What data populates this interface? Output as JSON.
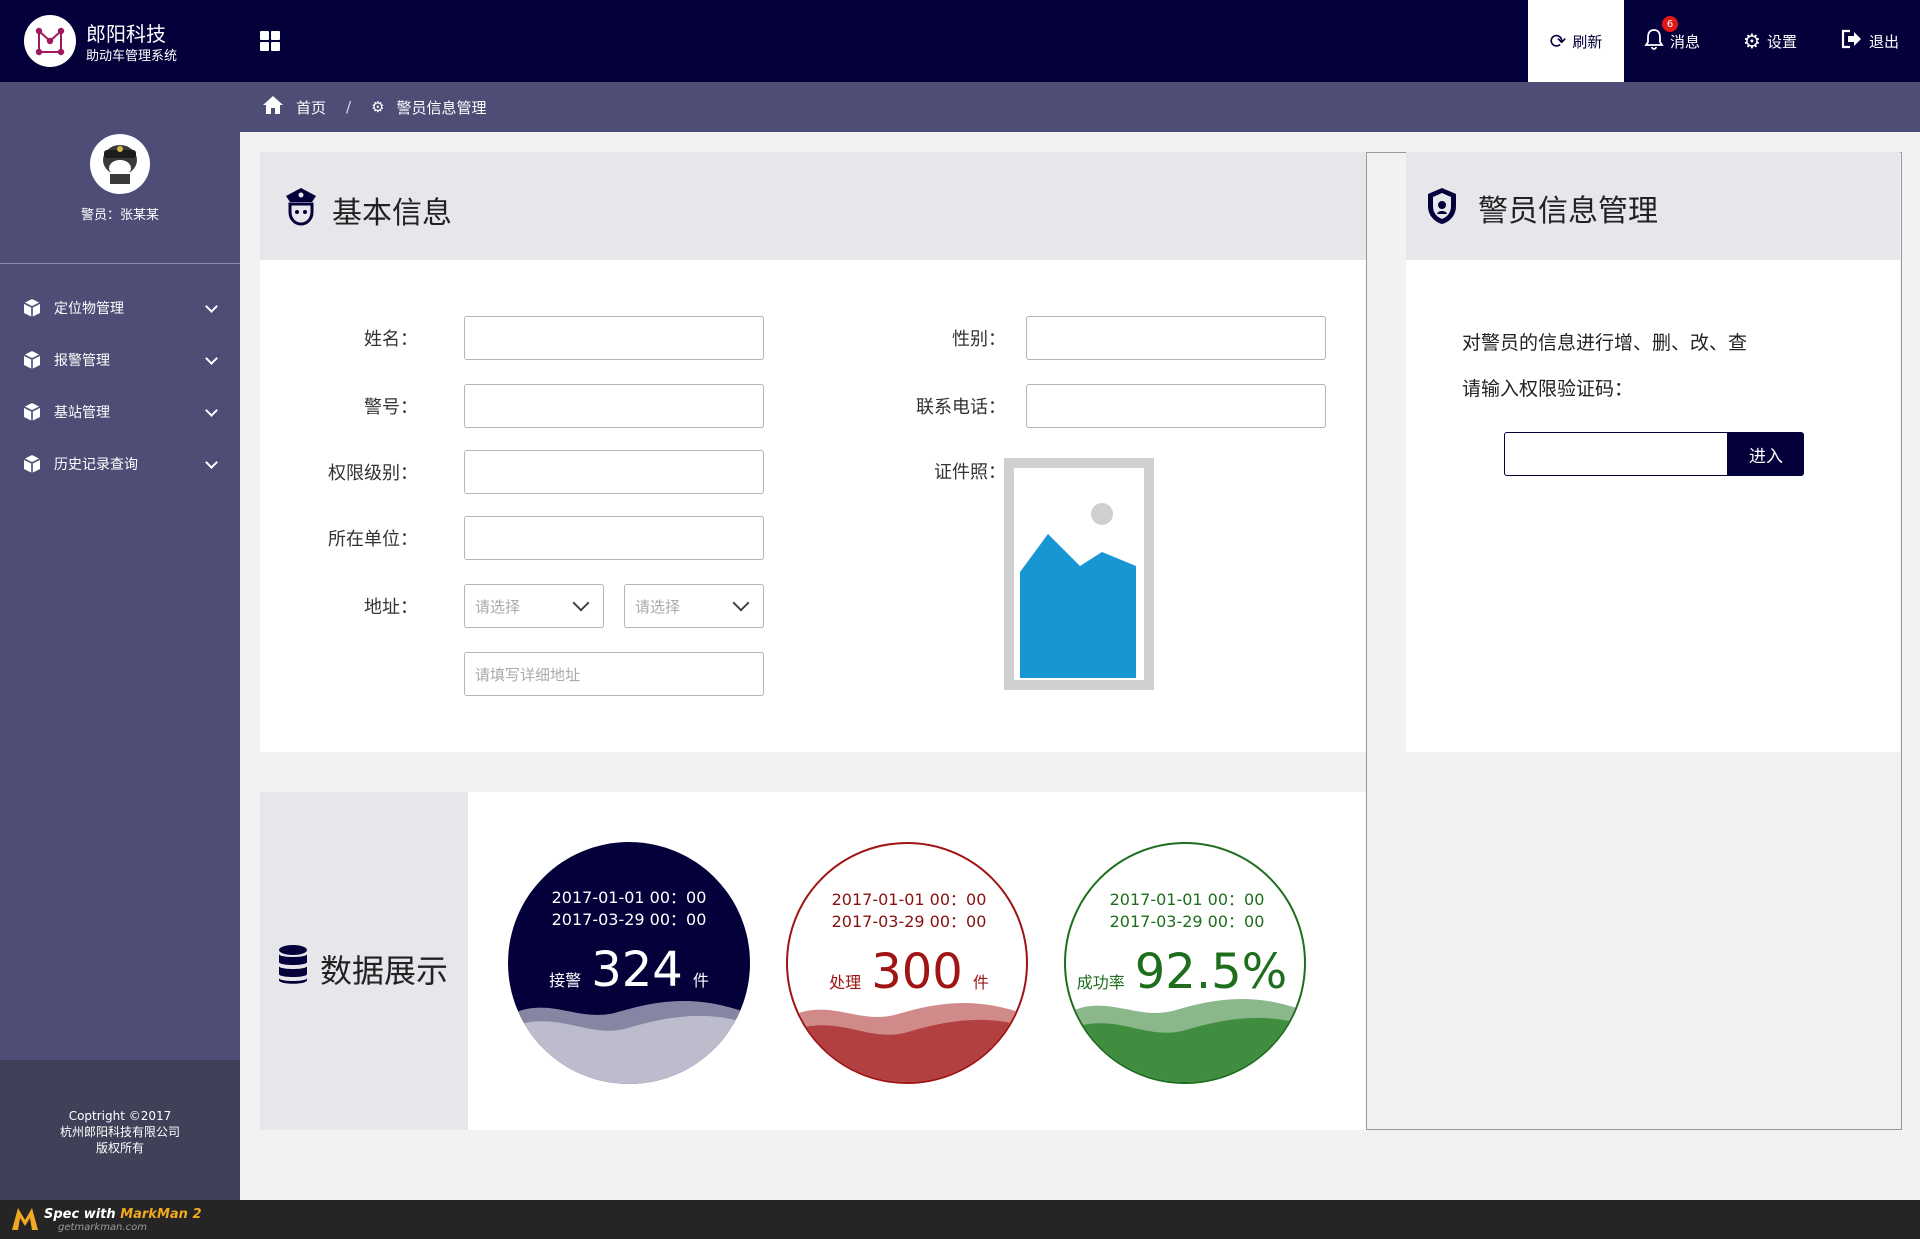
{
  "brand": {
    "name": "郎阳科技",
    "subtitle": "助动车管理系统"
  },
  "toolbar": {
    "refresh_label": "刷新",
    "messages_label": "消息",
    "messages_count": "6",
    "settings_label": "设置",
    "logout_label": "退出"
  },
  "user": {
    "display_name": "警员：张某某"
  },
  "sidebar": {
    "items": [
      {
        "label": "定位物管理"
      },
      {
        "label": "报警管理"
      },
      {
        "label": "基站管理"
      },
      {
        "label": "历史记录查询"
      }
    ],
    "footer_line1": "Coptright ©2017",
    "footer_line2": "杭州郎阳科技有限公司",
    "footer_line3": "版权所有"
  },
  "breadcrumb": {
    "home": "首页",
    "separator": "/",
    "current": "警员信息管理"
  },
  "basic_info": {
    "title": "基本信息",
    "name_label": "姓名：",
    "badge_label": "警号：",
    "permission_label": "权限级别：",
    "unit_label": "所在单位：",
    "address_label": "地址：",
    "province_placeholder": "请选择",
    "city_placeholder": "请选择",
    "address_detail_placeholder": "请填写详细地址",
    "gender_label": "性别：",
    "phone_label": "联系电话：",
    "id_photo_label": "证件照："
  },
  "manage": {
    "title": "警员信息管理",
    "description": "对警员的信息进行增、删、改、查",
    "prompt": "请输入权限验证码：",
    "enter_label": "进入"
  },
  "data_display": {
    "title": "数据展示",
    "cards": [
      {
        "date_from": "2017-01-01 00：00",
        "date_to": "2017-03-29 00：00",
        "label": "接警",
        "value": "324",
        "unit": "件",
        "color": "#03003a"
      },
      {
        "date_from": "2017-01-01 00：00",
        "date_to": "2017-03-29 00：00",
        "label": "处理",
        "value": "300",
        "unit": "件",
        "color": "#b24040"
      },
      {
        "date_from": "2017-01-01 00：00",
        "date_to": "2017-03-29 00：00",
        "label": "成功率",
        "value": "92.5%",
        "unit": "",
        "color": "#408d40"
      }
    ]
  },
  "colors": {
    "header": "#03003a",
    "sidebar": "#4e4d75",
    "panel_head": "#e6e6eb",
    "processed": "#b24040",
    "success": "#408d40"
  },
  "markman": {
    "text_prefix": "Spec with ",
    "text_brand": "MarkMan 2",
    "site": "getmarkman.com"
  }
}
